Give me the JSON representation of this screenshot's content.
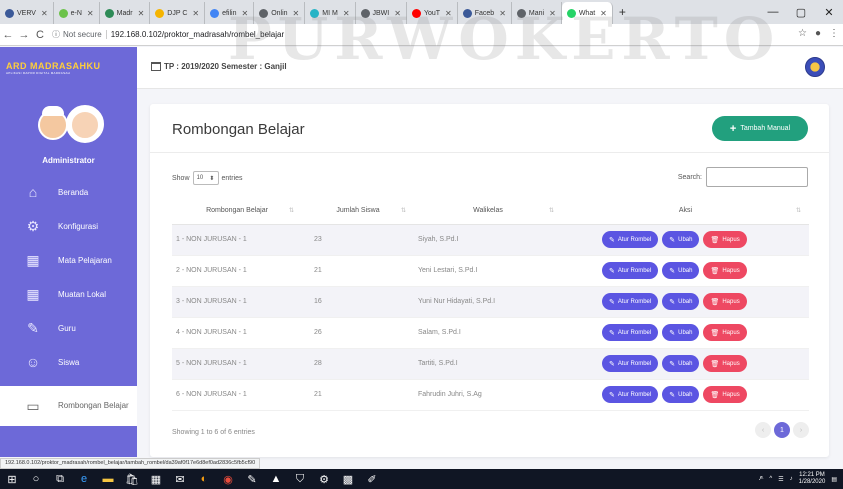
{
  "browser": {
    "tabs": [
      {
        "label": "VERV",
        "color": "#3b5998",
        "active": false
      },
      {
        "label": "e-N",
        "color": "#6cc24a",
        "active": false
      },
      {
        "label": "Madr",
        "color": "#2e8b57",
        "active": false
      },
      {
        "label": "DJP C",
        "color": "#f5b400",
        "active": false
      },
      {
        "label": "efilin",
        "color": "#4285f4",
        "active": false
      },
      {
        "label": "Onlin",
        "color": "#5f6368",
        "active": false
      },
      {
        "label": "MI M",
        "color": "#27b4c6",
        "active": false
      },
      {
        "label": "JBWI",
        "color": "#5f6368",
        "active": false
      },
      {
        "label": "YouT",
        "color": "#ff0000",
        "active": false
      },
      {
        "label": "Faceb",
        "color": "#3b5998",
        "active": false
      },
      {
        "label": "Mani",
        "color": "#5f6368",
        "active": false
      },
      {
        "label": "What",
        "color": "#25d366",
        "active": true
      }
    ],
    "new_tab": "+",
    "back": "←",
    "forward": "→",
    "reload": "C",
    "info_icon": "ⓘ",
    "not_secure": "Not secure",
    "url": "192.168.0.102/proktor_madrasah/rombel_belajar",
    "status_url": "192.168.0.102/proktor_madrasah/rombel_belajar/tambah_rombel/da39af0f17e6d8ef0ad2836c5fb5cf90"
  },
  "header": {
    "logo_line1": "ARD MADRASAHKU",
    "logo_line2": "APLIKASI RAPOR DIGITAL MADRASAH",
    "semester": "TP : 2019/2020  Semester : Ganjil"
  },
  "watermark": "PURWOKERTO",
  "sidebar": {
    "user": "Administrator",
    "items": [
      {
        "label": "Beranda",
        "icon": "⌂"
      },
      {
        "label": "Konfigurasi",
        "icon": "⚙"
      },
      {
        "label": "Mata Pelajaran",
        "icon": "▦"
      },
      {
        "label": "Muatan Lokal",
        "icon": "▦"
      },
      {
        "label": "Guru",
        "icon": "✎"
      },
      {
        "label": "Siswa",
        "icon": "☺"
      },
      {
        "label": "Rombongan Belajar",
        "icon": "▭"
      }
    ]
  },
  "main": {
    "title": "Rombongan Belajar",
    "add_button": "Tambah Manual",
    "show_label": "Show",
    "entries_value": "10",
    "entries_label": "entries",
    "search_label": "Search:",
    "search_value": "",
    "columns": [
      "Rombongan Belajar",
      "Jumlah Siswa",
      "Walikelas",
      "Aksi"
    ],
    "rows": [
      {
        "rombel": "1 - NON JURUSAN - 1",
        "jumlah": "23",
        "walikelas": "Siyah, S.Pd.I"
      },
      {
        "rombel": "2 - NON JURUSAN - 1",
        "jumlah": "21",
        "walikelas": "Yeni Lestari, S.Pd.I"
      },
      {
        "rombel": "3 - NON JURUSAN - 1",
        "jumlah": "16",
        "walikelas": "Yuni Nur Hidayati, S.Pd.I"
      },
      {
        "rombel": "4 - NON JURUSAN - 1",
        "jumlah": "26",
        "walikelas": "Salam, S.Pd.I"
      },
      {
        "rombel": "5 - NON JURUSAN - 1",
        "jumlah": "28",
        "walikelas": "Tartiti, S.Pd.I"
      },
      {
        "rombel": "6 - NON JURUSAN - 1",
        "jumlah": "21",
        "walikelas": "Fahrudin Juhri, S.Ag"
      }
    ],
    "actions": {
      "atur": "Atur Rombel",
      "ubah": "Ubah",
      "hapus": "Hapus"
    },
    "showing": "Showing 1 to 6 of 6 entries",
    "pager": {
      "prev": "‹",
      "current": "1",
      "next": "›"
    }
  },
  "taskbar": {
    "time": "12:21 PM",
    "date": "1/28/2020"
  },
  "colors": {
    "sidebar": "#6d69d8",
    "accent_green": "#22a07e",
    "action_blue": "#5b55e2",
    "action_red": "#ee4862"
  }
}
